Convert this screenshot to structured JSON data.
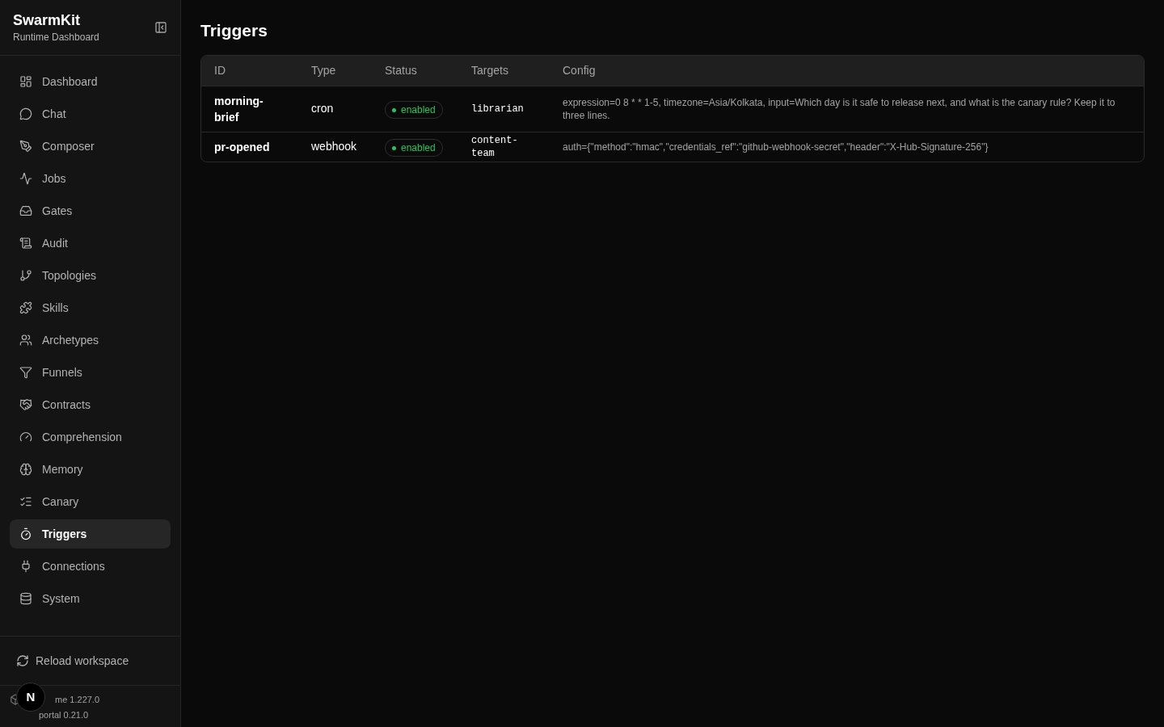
{
  "brand": {
    "title": "SwarmKit",
    "subtitle": "Runtime Dashboard"
  },
  "nav": [
    {
      "label": "Dashboard",
      "selected": false
    },
    {
      "label": "Chat",
      "selected": false
    },
    {
      "label": "Composer",
      "selected": false
    },
    {
      "label": "Jobs",
      "selected": false
    },
    {
      "label": "Gates",
      "selected": false
    },
    {
      "label": "Audit",
      "selected": false
    },
    {
      "label": "Topologies",
      "selected": false
    },
    {
      "label": "Skills",
      "selected": false
    },
    {
      "label": "Archetypes",
      "selected": false
    },
    {
      "label": "Funnels",
      "selected": false
    },
    {
      "label": "Contracts",
      "selected": false
    },
    {
      "label": "Comprehension",
      "selected": false
    },
    {
      "label": "Memory",
      "selected": false
    },
    {
      "label": "Canary",
      "selected": false
    },
    {
      "label": "Triggers",
      "selected": true
    },
    {
      "label": "Connections",
      "selected": false
    },
    {
      "label": "System",
      "selected": false
    }
  ],
  "reload_button": "Reload workspace",
  "versions": {
    "runtime": "me 1.227.0",
    "portal": "portal 0.21.0"
  },
  "dev_badge": "N",
  "page_title": "Triggers",
  "table": {
    "columns": [
      "ID",
      "Type",
      "Status",
      "Targets",
      "Config"
    ],
    "rows": [
      {
        "id": "morning-brief",
        "type": "cron",
        "status": "enabled",
        "enabled": true,
        "targets": "librarian",
        "config": "expression=0 8 * * 1-5, timezone=Asia/Kolkata, input=Which day is it safe to release next, and what is the canary rule? Keep it to three lines."
      },
      {
        "id": "pr-opened",
        "type": "webhook",
        "status": "enabled",
        "enabled": true,
        "targets": "content-team",
        "config": "auth={\"method\":\"hmac\",\"credentials_ref\":\"github-webhook-secret\",\"header\":\"X-Hub-Signature-256\"}"
      }
    ]
  }
}
